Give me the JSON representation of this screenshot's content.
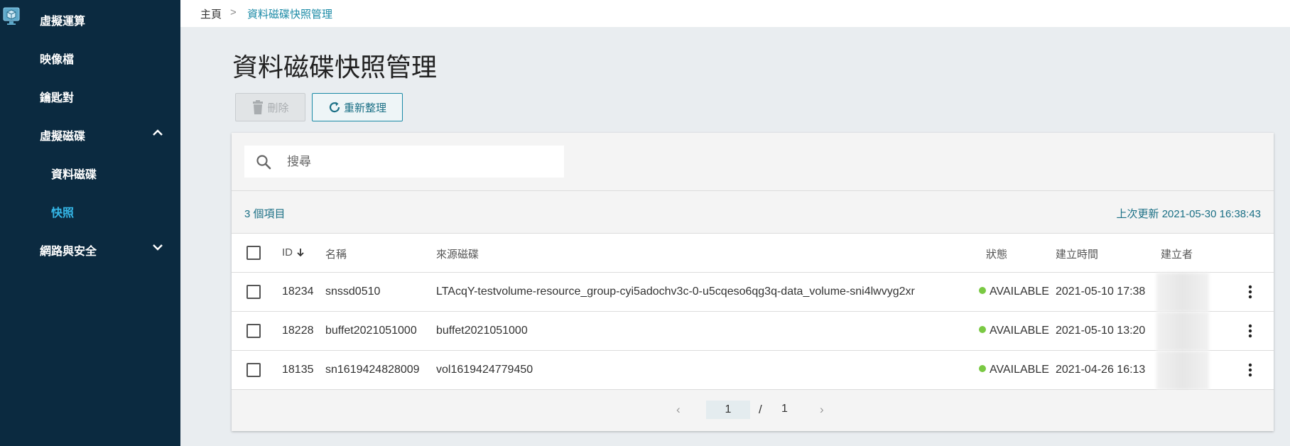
{
  "sidebar": {
    "items": [
      {
        "label": "虛擬運算"
      },
      {
        "label": "映像檔"
      },
      {
        "label": "鑰匙對"
      },
      {
        "label": "虛擬磁碟"
      },
      {
        "label": "資料磁碟"
      },
      {
        "label": "快照"
      },
      {
        "label": "網路與安全"
      }
    ]
  },
  "breadcrumb": {
    "home": "主頁",
    "separator": ">",
    "current": "資料磁碟快照管理"
  },
  "page": {
    "title": "資料磁碟快照管理"
  },
  "toolbar": {
    "delete_label": "刪除",
    "refresh_label": "重新整理"
  },
  "search": {
    "placeholder": "搜尋"
  },
  "summary": {
    "count": "3 個項目",
    "last_update": "上次更新 2021-05-30 16:38:43"
  },
  "table": {
    "headers": {
      "id": "ID",
      "name": "名稱",
      "source": "來源磁碟",
      "status": "狀態",
      "created_at": "建立時間",
      "creator": "建立者"
    },
    "rows": [
      {
        "id": "18234",
        "name": "snssd0510",
        "source": "LTAcqY-testvolume-resource_group-cyi5adochv3c-0-u5cqeso6qg3q-data_volume-sni4lwvyg2xr",
        "status": "AVAILABLE",
        "created_at": "2021-05-10 17:38"
      },
      {
        "id": "18228",
        "name": "buffet2021051000",
        "source": "buffet2021051000",
        "status": "AVAILABLE",
        "created_at": "2021-05-10 13:20"
      },
      {
        "id": "18135",
        "name": "sn1619424828009",
        "source": "vol1619424779450",
        "status": "AVAILABLE",
        "created_at": "2021-04-26 16:13"
      }
    ]
  },
  "pagination": {
    "current": "1",
    "separator": "/",
    "total": "1",
    "prev": "‹",
    "next": "›"
  },
  "colors": {
    "sidebar_bg": "#0b2a40",
    "accent": "#1a8aa6",
    "active_nav": "#35b7e8",
    "status_available": "#7ac943"
  }
}
